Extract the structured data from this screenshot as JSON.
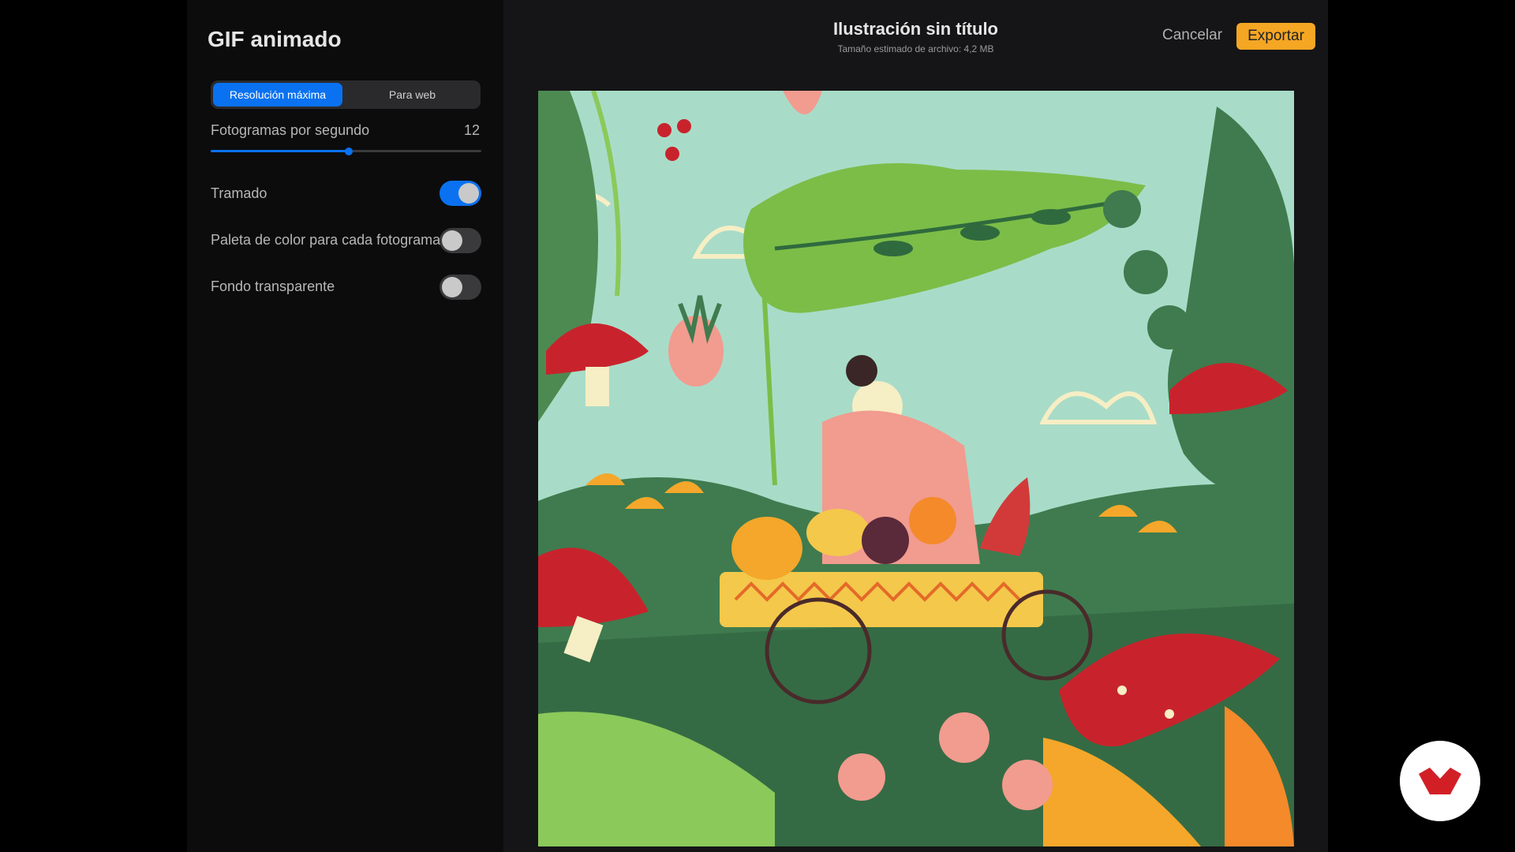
{
  "sidebar": {
    "title": "GIF animado",
    "resolution_tabs": [
      {
        "label": "Resolución máxima",
        "active": true
      },
      {
        "label": "Para web",
        "active": false
      }
    ],
    "fps": {
      "label": "Fotogramas por segundo",
      "value": "12",
      "fill_fraction": 0.51
    },
    "settings": [
      {
        "label": "Tramado",
        "on": true
      },
      {
        "label": "Paleta de color para cada fotograma",
        "on": false
      },
      {
        "label": "Fondo transparente",
        "on": false
      }
    ]
  },
  "header": {
    "title": "Ilustración sin título",
    "subtitle": "Tamaño estimado de archivo: 4,2 MB",
    "cancel_label": "Cancelar",
    "export_label": "Exportar"
  },
  "preview": {
    "icon": "illustration-preview"
  },
  "colors": {
    "accent_blue": "#0a72f0",
    "export_orange": "#f5a623",
    "badge_red": "#d21f26"
  },
  "badge_icon": "brand-logo-icon"
}
